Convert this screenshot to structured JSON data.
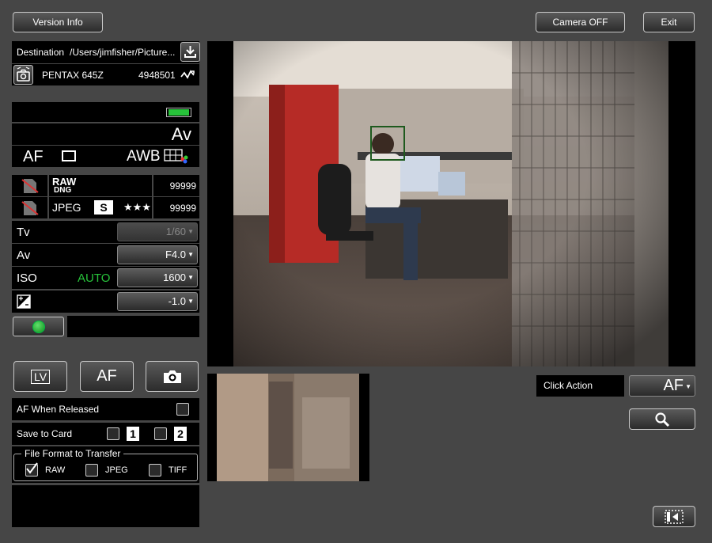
{
  "toolbar": {
    "version_info": "Version Info",
    "camera_off": "Camera OFF",
    "exit": "Exit"
  },
  "destination": {
    "label": "Destination",
    "path": "/Users/jimfisher/Picture..."
  },
  "camera": {
    "model": "PENTAX 645Z",
    "serial": "4948501"
  },
  "status": {
    "mode": "Av",
    "af": "AF",
    "wb": "AWB",
    "battery_level": 1.0
  },
  "storage": {
    "raw_format": "RAW",
    "raw_sub": "DNG",
    "raw_count": "99999",
    "jpeg_format": "JPEG",
    "jpeg_size": "S",
    "jpeg_quality": "★★★",
    "jpeg_count": "99999"
  },
  "exposure": {
    "tv_label": "Tv",
    "tv_value": "1/60",
    "av_label": "Av",
    "av_value": "F4.0",
    "iso_label": "ISO",
    "iso_auto": "AUTO",
    "iso_value": "1600",
    "ev_value": "-1.0"
  },
  "capture": {
    "lv_label": "LV",
    "af_label": "AF"
  },
  "options": {
    "af_when_released": "AF When Released",
    "save_to_card": "Save to Card",
    "card1": "1",
    "card2": "2",
    "file_format_legend": "File Format to Transfer",
    "raw": "RAW",
    "jpeg": "JPEG",
    "tiff": "TIFF"
  },
  "click_action": {
    "label": "Click Action",
    "value": "AF"
  },
  "colors": {
    "background": "#464646",
    "panel": "#000000",
    "accent_green": "#27c23a"
  }
}
